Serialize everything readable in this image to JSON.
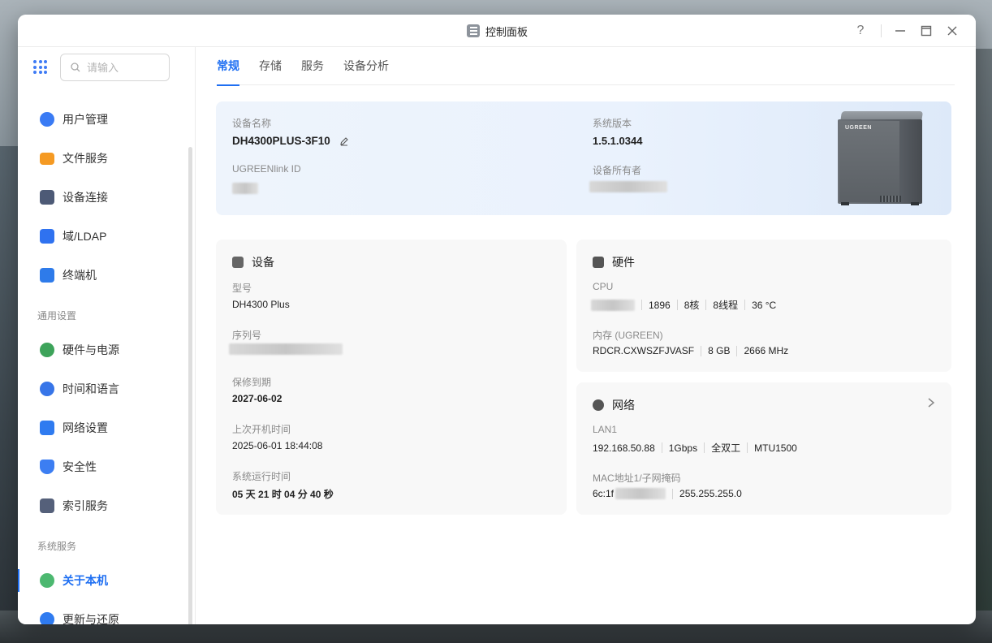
{
  "window": {
    "title": "控制面板",
    "buttons": {
      "help": "?",
      "minimize": "—",
      "maximize": "☐",
      "close": "✕"
    }
  },
  "sidebar": {
    "search_placeholder": "请输入",
    "items": [
      {
        "label": "用户管理",
        "icon": "users-icon",
        "color": "#3a7bf4"
      },
      {
        "label": "文件服务",
        "icon": "folder-icon",
        "color": "#f59a23"
      },
      {
        "label": "设备连接",
        "icon": "device-link-icon",
        "color": "#4d5a76"
      },
      {
        "label": "域/LDAP",
        "icon": "domain-icon",
        "color": "#2f72f0"
      }
    ],
    "item_terminal": {
      "label": "终端机",
      "icon": "terminal-icon",
      "color": "#2e7bea"
    },
    "section_general": "通用设置",
    "general_items": [
      {
        "label": "硬件与电源",
        "icon": "hardware-power-icon",
        "color": "#3da35a"
      },
      {
        "label": "时间和语言",
        "icon": "globe-clock-icon",
        "color": "#3775e8"
      },
      {
        "label": "网络设置",
        "icon": "network-icon",
        "color": "#2f7bf0"
      },
      {
        "label": "安全性",
        "icon": "shield-icon",
        "color": "#3c7ef2"
      },
      {
        "label": "索引服务",
        "icon": "index-icon",
        "color": "#55607a"
      }
    ],
    "section_system": "系统服务",
    "system_items": [
      {
        "label": "关于本机",
        "icon": "info-icon",
        "color": "#4cb870",
        "active": true
      },
      {
        "label": "更新与还原",
        "icon": "refresh-icon",
        "color": "#2f7bf0"
      }
    ]
  },
  "tabs": [
    {
      "label": "常规",
      "active": true
    },
    {
      "label": "存储"
    },
    {
      "label": "服务"
    },
    {
      "label": "设备分析"
    }
  ],
  "overview": {
    "device_name_label": "设备名称",
    "device_name": "DH4300PLUS-3F10",
    "ugreenlink_label": "UGREENlink ID",
    "system_version_label": "系统版本",
    "system_version": "1.5.1.0344",
    "owner_label": "设备所有者",
    "nas_brand": "UGREEN"
  },
  "device_card": {
    "title": "设备",
    "model_label": "型号",
    "model": "DH4300 Plus",
    "serial_label": "序列号",
    "warranty_label": "保修到期",
    "warranty": "2027-06-02",
    "last_boot_label": "上次开机时间",
    "last_boot": "2025-06-01 18:44:08",
    "uptime_label": "系统运行时间",
    "uptime": "05 天 21 时 04 分 40 秒"
  },
  "hardware_card": {
    "title": "硬件",
    "cpu_label": "CPU",
    "cpu_freq": "1896",
    "cpu_cores": "8核",
    "cpu_threads": "8线程",
    "cpu_temp": "36 °C",
    "memory_label": "内存 (UGREEN)",
    "memory_model": "RDCR.CXWSZFJVASF",
    "memory_size": "8 GB",
    "memory_speed": "2666 MHz"
  },
  "network_card": {
    "title": "网络",
    "lan_label": "LAN1",
    "ip": "192.168.50.88",
    "speed": "1Gbps",
    "duplex": "全双工",
    "mtu": "MTU1500",
    "mac_label": "MAC地址1/子网掩码",
    "mac_prefix": "6c:1f",
    "subnet": "255.255.255.0"
  },
  "colors": {
    "accent": "#1f6ff2"
  }
}
